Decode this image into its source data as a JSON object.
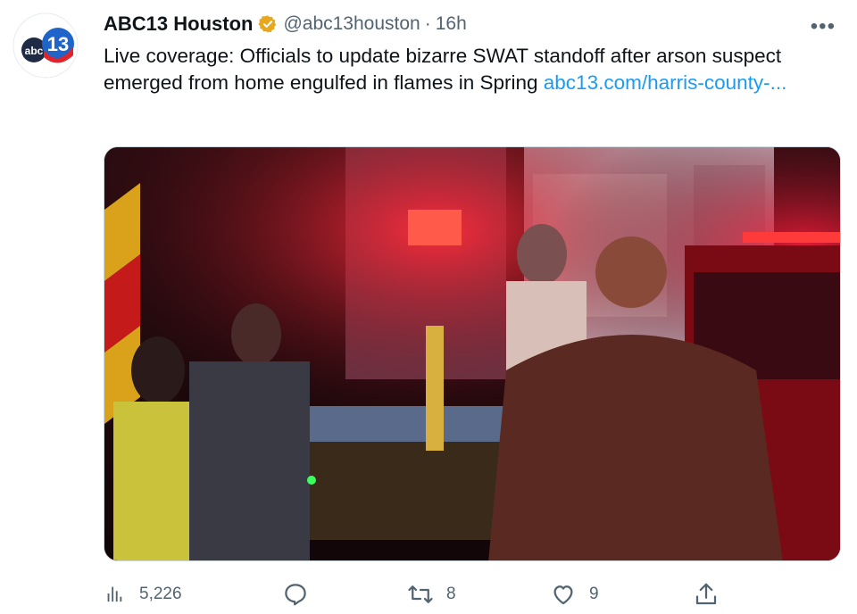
{
  "tweet": {
    "author_name": "ABC13 Houston",
    "handle": "@abc13houston",
    "separator": "·",
    "time": "16h",
    "more_label": "•••",
    "text": "Live coverage: Officials to update bizarre SWAT standoff after arson suspect emerged from home engulfed in flames in Spring",
    "link_text": "abc13.com/harris-county-...",
    "avatar_logo_text": "abc13",
    "colors": {
      "link": "#1d9bf0",
      "verified": "#e8a71c",
      "muted": "#536471",
      "brand_blue": "#1f64c8",
      "brand_red": "#e0242b"
    }
  },
  "media": {
    "description_icon": "photo-icon"
  },
  "actions": {
    "views": "5,226",
    "replies": "",
    "retweets": "8",
    "likes": "9",
    "share": ""
  }
}
